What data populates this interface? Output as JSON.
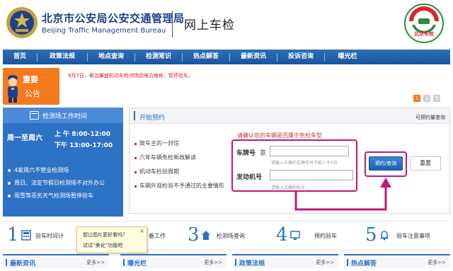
{
  "header": {
    "bureau_cn": "北京市公安局公安交通管理局",
    "bureau_en": "Beijing Traffic Management Bureau",
    "site_title": "网上车检",
    "logo_text": "北京车检"
  },
  "nav": [
    "首页",
    "政策法规",
    "地点查询",
    "检测常识",
    "热点解答",
    "最新资讯",
    "投诉咨询",
    "曝光栏"
  ],
  "notice": {
    "label_top": "重要",
    "label_bottom": "公告",
    "text": "9月7日，奢北翼盛机动车检测场因电力维修，暂停验车。",
    "pages": [
      "1",
      "2",
      "3"
    ],
    "active_page": 1
  },
  "hours": {
    "title": "检测场工作时间",
    "days": "周一至周六",
    "am": "上 午 8:00-12:00",
    "pm": "下午 13:00-17:00",
    "notes": [
      "4家周六不营业检测场",
      "周日、法定节假日检测场不对外办公",
      "雨雪等恶劣天气检测场暂停验车"
    ]
  },
  "booking": {
    "title": "开始预约",
    "query_link": "可预约量查询",
    "info_links": [
      "致车主的一封信",
      "六年车辆免检新政解读",
      "机动车检验周期",
      "车辆外观检验不予通过的主要情形"
    ],
    "hint": "请确认您的车辆是否属于免检车型",
    "plate_label": "车牌号",
    "plate_prefix": "京",
    "plate_note": "请输入正确的车牌号并不能少于5位",
    "engine_label": "发动机号",
    "engine_note": "请输入正确的机号",
    "submit_label": "预约/查询",
    "reset_label": "重置",
    "accent_color": "#c2177a"
  },
  "steps": [
    {
      "num": "1",
      "label": "验车时间计"
    },
    {
      "num": "2",
      "label": "备工作"
    },
    {
      "num": "3",
      "label": "检测场查询"
    },
    {
      "num": "4",
      "label": "预约验车"
    },
    {
      "num": "5",
      "label": "验车注意事项"
    }
  ],
  "tooltip": {
    "line1": "想让图片更好看吗？",
    "line2": "试试“美化”功能吧",
    "close": "×"
  },
  "bottom_panels": [
    {
      "title": "最新资讯",
      "more": "更多>>"
    },
    {
      "title": "曝光栏",
      "more": "更多>>"
    },
    {
      "title": "政策法规",
      "more": "更多>>"
    },
    {
      "title": "热点解答",
      "more": "更多>>"
    }
  ]
}
